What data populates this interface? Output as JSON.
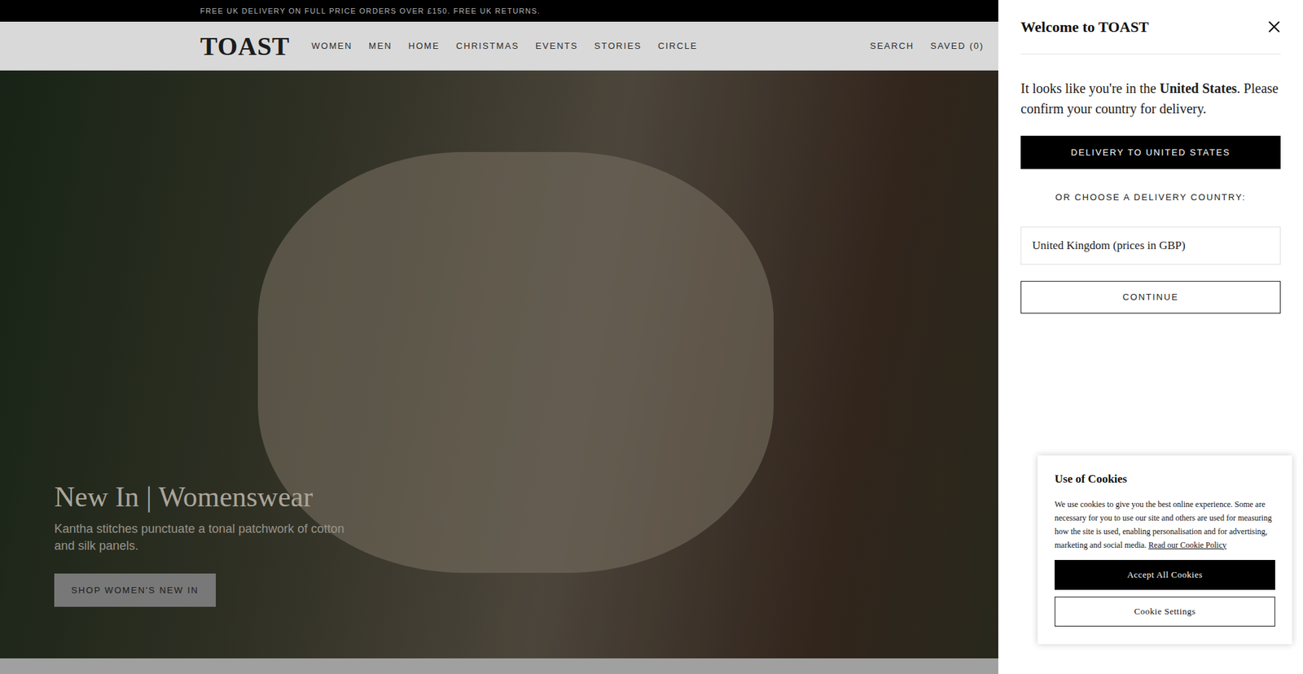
{
  "promo_bar": {
    "text": "FREE UK DELIVERY ON FULL PRICE ORDERS OVER £150. FREE UK RETURNS."
  },
  "nav": {
    "logo": "TOAST",
    "items": [
      "WOMEN",
      "MEN",
      "HOME",
      "CHRISTMAS",
      "EVENTS",
      "STORIES",
      "CIRCLE"
    ],
    "search": "SEARCH",
    "saved": "SAVED (0)"
  },
  "hero": {
    "title": "New In | Womenswear",
    "subtitle": "Kantha stitches punctuate a tonal patchwork of cotton and silk panels.",
    "button": "SHOP WOMEN'S NEW IN"
  },
  "country_panel": {
    "title": "Welcome to TOAST",
    "message_before": "It looks like you're in the ",
    "message_country": "United States",
    "message_after": ". Please confirm your country for delivery.",
    "primary_button": "DELIVERY TO UNITED STATES",
    "choose_label": "OR CHOOSE A DELIVERY COUNTRY:",
    "select_value": "United Kingdom (prices in GBP)",
    "continue_button": "CONTINUE"
  },
  "cookie_banner": {
    "title": "Use of Cookies",
    "body": "We use cookies to give you the best online experience. Some are necessary for you to use our site and others are used for measuring how the site is used, enabling personalisation and for advertising, marketing and social media. ",
    "link": "Read our Cookie Policy",
    "accept_button": "Accept All Cookies",
    "settings_button": "Cookie Settings"
  }
}
